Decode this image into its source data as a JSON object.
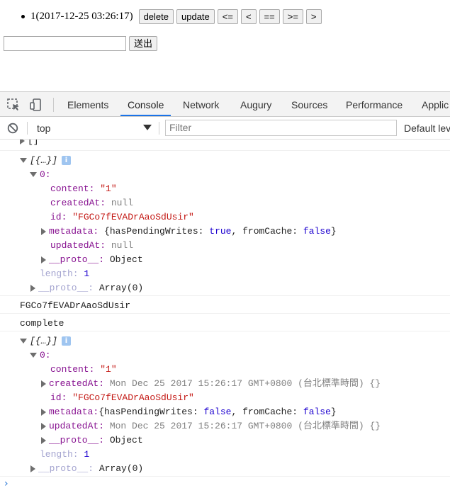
{
  "page": {
    "todo_text": "1(2017-12-25 03:26:17)",
    "buttons": [
      "delete",
      "update",
      "<=",
      "<",
      "==",
      ">=",
      ">"
    ],
    "input_value": "",
    "submit_label": "送出"
  },
  "devtools": {
    "tabs": [
      "Elements",
      "Console",
      "Network",
      "Augury",
      "Sources",
      "Performance",
      "Applic"
    ],
    "active_tab": "Console",
    "context": "top",
    "filter_placeholder": "Filter",
    "levels_label": "Default lev"
  },
  "console": {
    "top_fragment": "[]",
    "array_label": "[{…}]",
    "info": "i",
    "g1": {
      "index": "0:",
      "content_key": "content:",
      "content_val": "\"1\"",
      "created_key": "createdAt:",
      "created_val": "null",
      "id_key": "id:",
      "id_val": "\"FGCo7fEVADrAaoSdUsir\"",
      "meta_key": "metadata:",
      "meta_open": "{hasPendingWrites: ",
      "meta_v1": "true",
      "meta_mid": ", fromCache: ",
      "meta_v2": "false",
      "meta_close": "}",
      "updated_key": "updatedAt:",
      "updated_val": "null",
      "proto_key": "__proto__:",
      "proto_val": "Object",
      "length_key": "length:",
      "length_val": "1",
      "arr_proto_key": "__proto__:",
      "arr_proto_val": "Array(0)"
    },
    "log_id": "FGCo7fEVADrAaoSdUsir",
    "log_complete": "complete",
    "g2": {
      "index": "0:",
      "content_key": "content:",
      "content_val": "\"1\"",
      "created_key": "createdAt:",
      "created_val": "Mon Dec 25 2017 15:26:17 GMT+0800 (台北標準時間) {}",
      "id_key": "id:",
      "id_val": "\"FGCo7fEVADrAaoSdUsir\"",
      "meta_key": "metadata:",
      "meta_open": "{hasPendingWrites: ",
      "meta_v1": "false",
      "meta_mid": ", fromCache: ",
      "meta_v2": "false",
      "meta_close": "}",
      "updated_key": "updatedAt:",
      "updated_val": "Mon Dec 25 2017 15:26:17 GMT+0800 (台北標準時間) {}",
      "proto_key": "__proto__:",
      "proto_val": "Object",
      "length_key": "length:",
      "length_val": "1",
      "arr_proto_key": "__proto__:",
      "arr_proto_val": "Array(0)"
    },
    "prompt": "›"
  },
  "colors": {
    "accent": "#1a73e8",
    "key": "#881391",
    "string": "#c41a16",
    "keyword": "#1c00cf"
  }
}
